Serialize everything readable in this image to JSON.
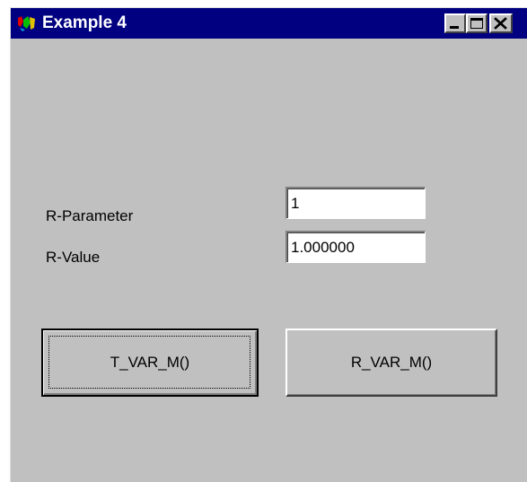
{
  "window": {
    "title": "Example 4",
    "icon": "app-icon",
    "controls": [
      "minimize-icon",
      "maximize-icon",
      "close-icon"
    ]
  },
  "form": {
    "r_parameter_label": "R-Parameter",
    "r_parameter_value": "1",
    "r_value_label": "R-Value",
    "r_value_value": "1.000000"
  },
  "buttons": {
    "t_var_m_label": "T_VAR_M()",
    "r_var_m_label": "R_VAR_M()"
  },
  "colors": {
    "titlebar": "#000080",
    "window_bg": "#c0c0c0",
    "field_bg": "#ffffff"
  }
}
